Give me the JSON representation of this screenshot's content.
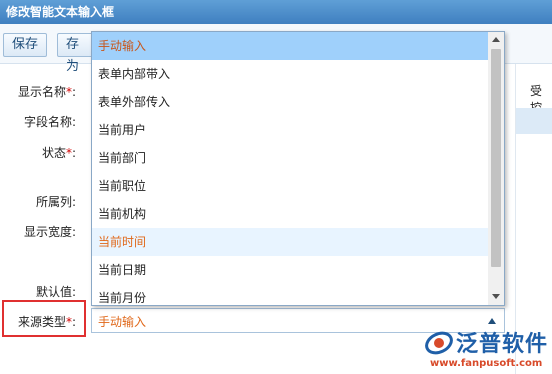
{
  "window": {
    "title": "修改智能文本输入框"
  },
  "toolbar": {
    "save_label": "保存",
    "save_as_label": "存为"
  },
  "form": {
    "labels": {
      "display_name": "显示名称",
      "field_name": "字段名称:",
      "status": "状态",
      "column": "所属列:",
      "display_width": "显示宽度:",
      "default_value": "默认值:",
      "source_type": "来源类型"
    },
    "required_mark": "*",
    "colon": ":",
    "source_type_value": "手动输入",
    "right_label": "受控"
  },
  "dropdown": {
    "options": [
      "手动输入",
      "表单内部带入",
      "表单外部传入",
      "当前用户",
      "当前部门",
      "当前职位",
      "当前机构",
      "当前时间",
      "当前日期",
      "当前月份"
    ],
    "selected_index": 0,
    "hover_index": 7
  },
  "logo": {
    "brand": "泛普软件",
    "url": "www.fanpusoft.com"
  },
  "colors": {
    "accent": "#e0681a",
    "selected_bg": "#9fd0fb",
    "title_bar": "#4a8ac8",
    "highlight_frame": "#e03030"
  }
}
